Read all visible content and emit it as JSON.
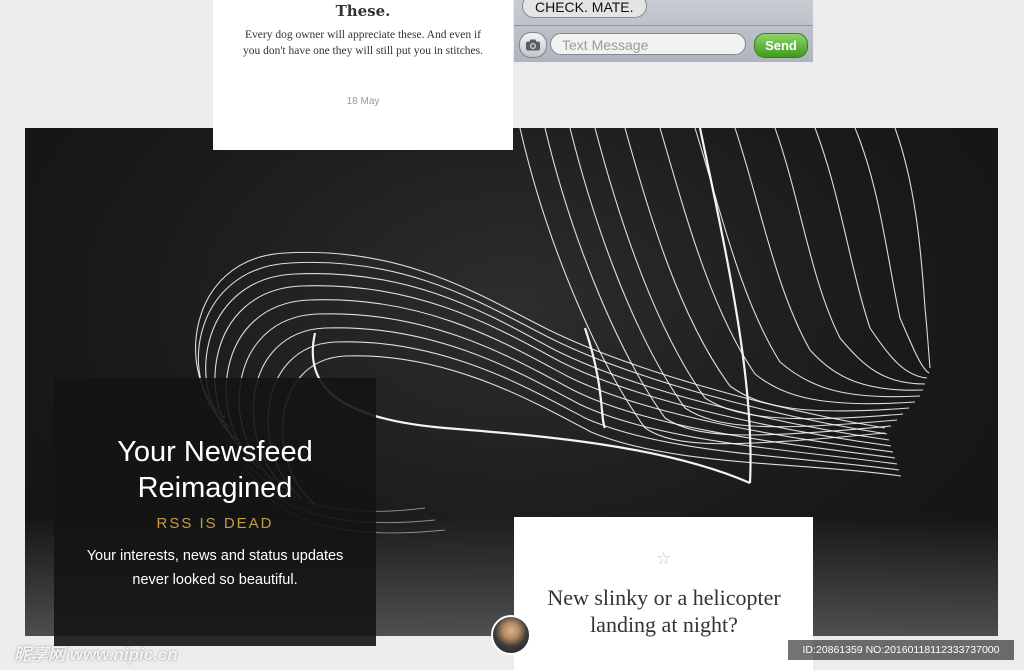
{
  "top_card": {
    "title": "These.",
    "excerpt": "Every dog owner will appreciate these. And even if you don't have one they will still put you in stitches.",
    "date": "18 May"
  },
  "imessage": {
    "bubble_text": "CHECK. MATE.",
    "input_placeholder": "Text Message",
    "send_label": "Send",
    "camera_icon": "camera-icon",
    "send_color": "#4caf2a"
  },
  "hero": {
    "headline": "Your Newsfeed Reimagined",
    "kicker": "RSS IS DEAD",
    "description": "Your interests, news and status updates never looked so beautiful.",
    "accent_color": "#c79a45"
  },
  "bottom_card": {
    "star_icon": "star-icon",
    "title": "New slinky or a helicopter landing at night?"
  },
  "watermark": {
    "left": "昵享网 www.nipic.cn",
    "right": "ID:20861359 NO:20160118112333737000"
  }
}
